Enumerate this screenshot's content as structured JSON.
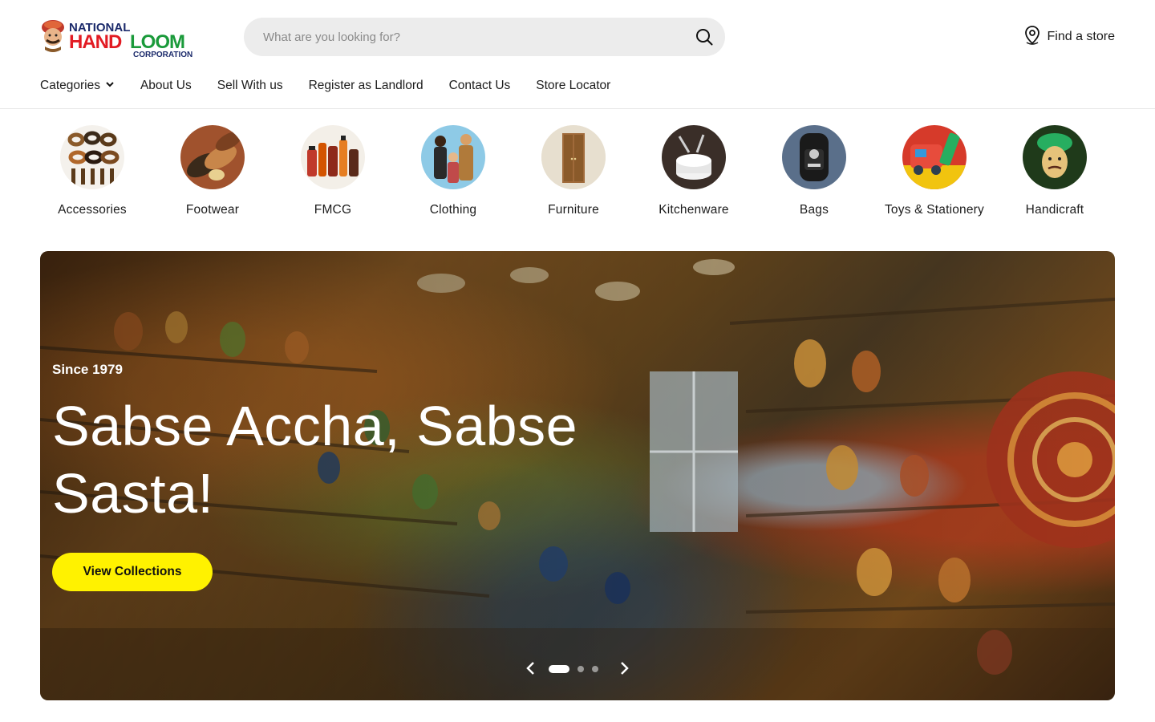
{
  "brand": {
    "logo_line1": "NATIONAL",
    "logo_line2a": "HAND",
    "logo_line2b": "LOOM",
    "logo_line3": "CORPORATION",
    "colors": {
      "red": "#e21b23",
      "green": "#1a9a3a",
      "navy": "#1b2a6b",
      "accent_yellow": "#fff200"
    }
  },
  "search": {
    "placeholder": "What are you looking for?",
    "value": ""
  },
  "header": {
    "find_store_label": "Find a store"
  },
  "nav": {
    "items": [
      {
        "label": "Categories"
      },
      {
        "label": "About Us"
      },
      {
        "label": "Sell With us"
      },
      {
        "label": "Register as Landlord"
      },
      {
        "label": "Contact Us"
      },
      {
        "label": "Store Locator"
      }
    ]
  },
  "categories": [
    {
      "label": "Accessories",
      "icon": "belts-image"
    },
    {
      "label": "Footwear",
      "icon": "shoes-image"
    },
    {
      "label": "FMCG",
      "icon": "bottles-image"
    },
    {
      "label": "Clothing",
      "icon": "family-image"
    },
    {
      "label": "Furniture",
      "icon": "cabinet-image"
    },
    {
      "label": "Kitchenware",
      "icon": "plates-image"
    },
    {
      "label": "Bags",
      "icon": "backpack-image"
    },
    {
      "label": "Toys & Stationery",
      "icon": "toys-image"
    },
    {
      "label": "Handicraft",
      "icon": "handicraft-image"
    }
  ],
  "hero": {
    "eyebrow": "Since 1979",
    "headline": "Sabse Accha, Sabse Sasta!",
    "cta_label": "View Collections",
    "slide_count": 3,
    "active_slide": 1
  }
}
